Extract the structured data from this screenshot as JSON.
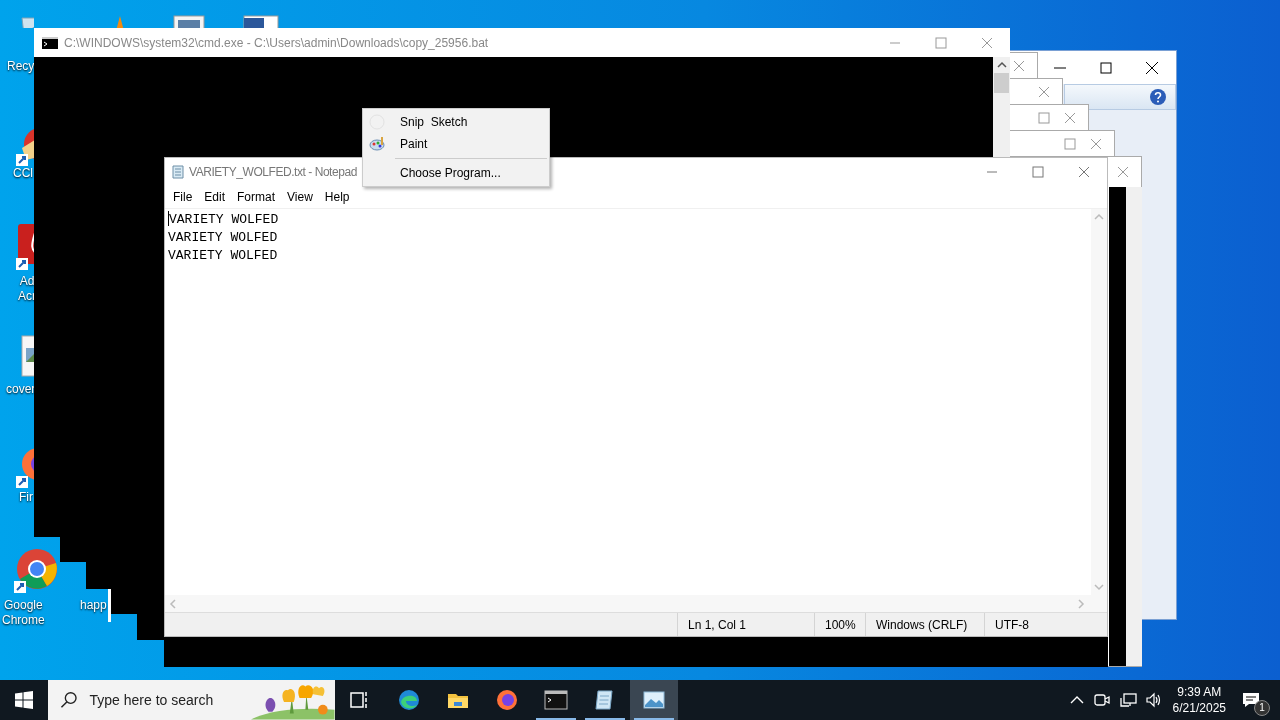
{
  "desktop_icons": [
    {
      "kind": "recycle-bin",
      "label": "Recy"
    },
    {
      "kind": "vlc"
    },
    {
      "kind": "document"
    },
    {
      "kind": "word"
    },
    {
      "kind": "ccleaner",
      "label": "CCl"
    },
    {
      "kind": "acrobat",
      "label": "Ad\nAcr"
    },
    {
      "kind": "image-file",
      "label": "cover"
    },
    {
      "kind": "firefox",
      "label": "Fir"
    },
    {
      "kind": "chrome",
      "label": "Google\nChrome"
    },
    {
      "kind": "hidden",
      "label": "happ"
    }
  ],
  "cmd_window": {
    "title": "C:\\WINDOWS\\system32\\cmd.exe - C:\\Users\\admin\\Downloads\\copy_25956.bat"
  },
  "notepad": {
    "title": "VARIETY_WOLFED.txt - Notepad",
    "menu": [
      "File",
      "Edit",
      "Format",
      "View",
      "Help"
    ],
    "lines": [
      "VARIETY WOLFED",
      "VARIETY WOLFED",
      "VARIETY WOLFED"
    ],
    "status": [
      "Ln 1, Col 1",
      "100%",
      "Windows (CRLF)",
      "UTF-8"
    ]
  },
  "context_menu": {
    "items": [
      {
        "kind": "snip",
        "label": "Snip  Sketch"
      },
      {
        "kind": "paint",
        "label": "Paint"
      },
      {
        "kind": "separator"
      },
      {
        "kind": "plain",
        "label": "Choose Program..."
      }
    ]
  },
  "taskbar": {
    "search": {
      "placeholder": "Type here to search"
    },
    "apps": [
      {
        "kind": "task-view",
        "running": false,
        "selected": false
      },
      {
        "kind": "edge",
        "running": false,
        "selected": false
      },
      {
        "kind": "explorer",
        "running": false,
        "selected": false
      },
      {
        "kind": "firefox",
        "running": false,
        "selected": false
      },
      {
        "kind": "terminal",
        "running": true,
        "selected": false
      },
      {
        "kind": "notepad",
        "running": true,
        "selected": false
      },
      {
        "kind": "photos",
        "running": true,
        "selected": true
      }
    ],
    "time": "9:39 AM",
    "date": "6/21/2025",
    "notifications": "1"
  }
}
